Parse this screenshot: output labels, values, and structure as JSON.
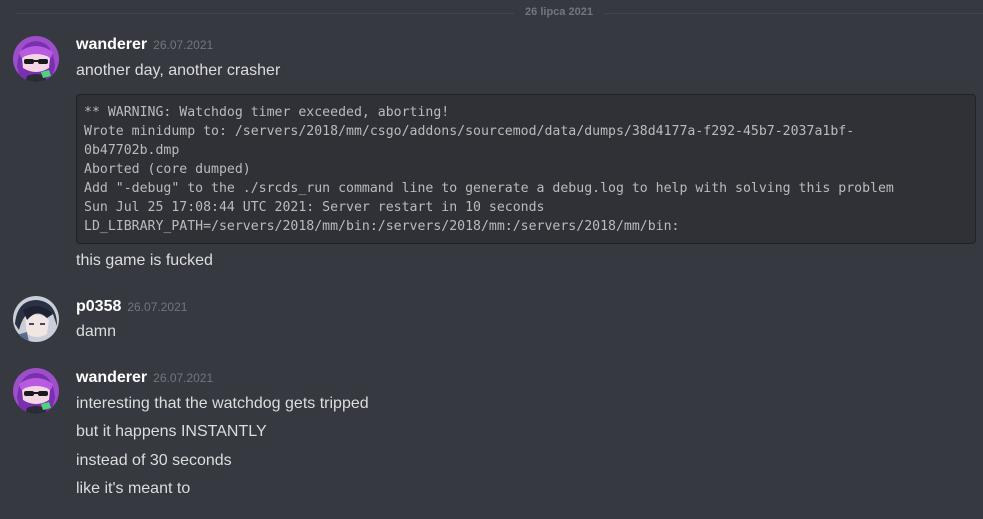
{
  "divider": {
    "date": "26 lipca 2021"
  },
  "messages": [
    {
      "author": "wanderer",
      "timestamp": "26.07.2021",
      "avatar": "anime-girl-purple-hair-avatar",
      "lines": [
        "another day, another crasher"
      ],
      "code": [
        "** WARNING: Watchdog timer exceeded, aborting!",
        "Wrote minidump to: /servers/2018/mm/csgo/addons/sourcemod/data/dumps/38d4177a-f292-45b7-2037a1bf-",
        "0b47702b.dmp",
        "Aborted (core dumped)",
        "Add \"-debug\" to the ./srcds_run command line to generate a debug.log to help with solving this problem",
        "Sun Jul 25 17:08:44 UTC 2021: Server restart in 10 seconds",
        "LD_LIBRARY_PATH=/servers/2018/mm/bin:/servers/2018/mm:/servers/2018/mm/bin:"
      ],
      "after_code": "this game is fucked"
    },
    {
      "author": "p0358",
      "timestamp": "26.07.2021",
      "avatar": "anime-boy-dark-hair-avatar",
      "lines": [
        "damn"
      ]
    },
    {
      "author": "wanderer",
      "timestamp": "26.07.2021",
      "avatar": "anime-girl-purple-hair-avatar",
      "lines": [
        "interesting that the watchdog gets tripped",
        "but it happens INSTANTLY",
        "instead of 30 seconds",
        "like it's meant to"
      ]
    }
  ]
}
